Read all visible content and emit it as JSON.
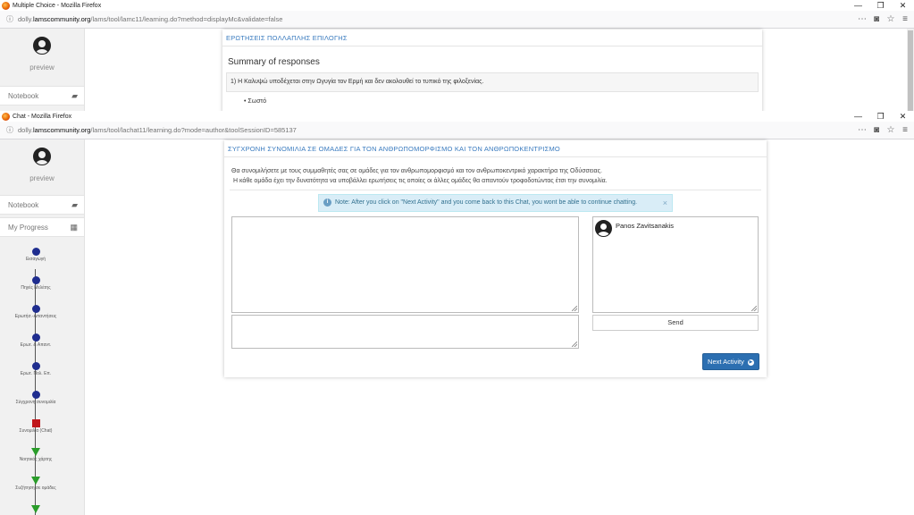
{
  "back_window": {
    "title": "Multiple Choice - Mozilla Firefox",
    "url_prefix": "dolly.",
    "url_domain": "lamscommunity.org",
    "url_rest": "/lams/tool/lamc11/learning.do?method=displayMc&validate=false",
    "sidebar": {
      "preview": "preview",
      "notebook": "Notebook"
    },
    "panel": {
      "header": "ΕΡΩΤΗΣΕΙΣ ΠΟΛΛΑΠΛΗΣ ΕΠΙΛΟΓΗΣ",
      "summary_title": "Summary of responses",
      "question": "1) Η Καλυψώ υποδέχεται στην Ωγυγία τον Ερμή και  δεν ακολουθεί το τυπικό της φιλοξενίας.",
      "answer": "Σωστό"
    }
  },
  "front_window": {
    "title": "Chat - Mozilla Firefox",
    "url_prefix": "dolly.",
    "url_domain": "lamscommunity.org",
    "url_rest": "/lams/tool/lachat11/learning.do?mode=author&toolSessionID=585137",
    "sidebar": {
      "preview": "preview",
      "notebook": "Notebook",
      "my_progress": "My Progress",
      "progress_items": [
        {
          "label": "Εισαγωγή",
          "state": "done"
        },
        {
          "label": "Πηγές Μελέτης",
          "state": "done"
        },
        {
          "label": "Ερωτήσ.-Απαντήσεις",
          "state": "done"
        },
        {
          "label": "Ερωτ. & Απαντ.",
          "state": "done"
        },
        {
          "label": "Ερωτ. Πολ. Επ.",
          "state": "done"
        },
        {
          "label": "Σύγχρονη συνομιλία",
          "state": "done"
        },
        {
          "label": "Συνομιλία (Chat)",
          "state": "current"
        },
        {
          "label": "Νοητικός χάρτης",
          "state": "todo"
        },
        {
          "label": "Συζήτηση σε ομάδες",
          "state": "todo"
        },
        {
          "label": "",
          "state": "todo"
        }
      ]
    },
    "panel": {
      "header": "ΣΥΓΧΡΟΝΗ ΣΥΝΟΜΙΛΙΑ ΣΕ ΟΜΑΔΕΣ ΓΙΑ ΤΟΝ ΑΝΘΡΩΠΟΜΟΡΦΙΣΜΟ ΚΑΙ ΤΟΝ ΑΝΘΡΩΠΟΚΕΝΤΡΙΣΜΟ",
      "intro_line1": "Θα συνομιλήσετε με τους συμμαθητές σας σε ομάδες για τον ανθρωπομορφισμό και τον ανθρωποκεντρικό χαρακτήρα της Οδύσσειας.",
      "intro_line2": "Η κάθε ομάδα έχει την δυνατότητα να υποβάλλει ερωτήσεις τις οποίες οι άλλες ομάδες θα απαντούν τροφοδοτώντας έτσι την συνομιλία.",
      "note": "Note: After you click on \"Next Activity\" and you come back to this Chat, you wont be able to continue chatting.",
      "users": [
        "Panos Zavitsanakis"
      ],
      "send_label": "Send",
      "next_label": "Next Activity"
    }
  },
  "window_controls": {
    "minimize": "—",
    "restore": "❐",
    "close": "✕"
  },
  "colors": {
    "accent": "#3a7bbf",
    "button_primary": "#2c6fb1",
    "progress_done": "#1f2d8f",
    "progress_current": "#c0171b",
    "progress_todo": "#2a9d2a"
  }
}
